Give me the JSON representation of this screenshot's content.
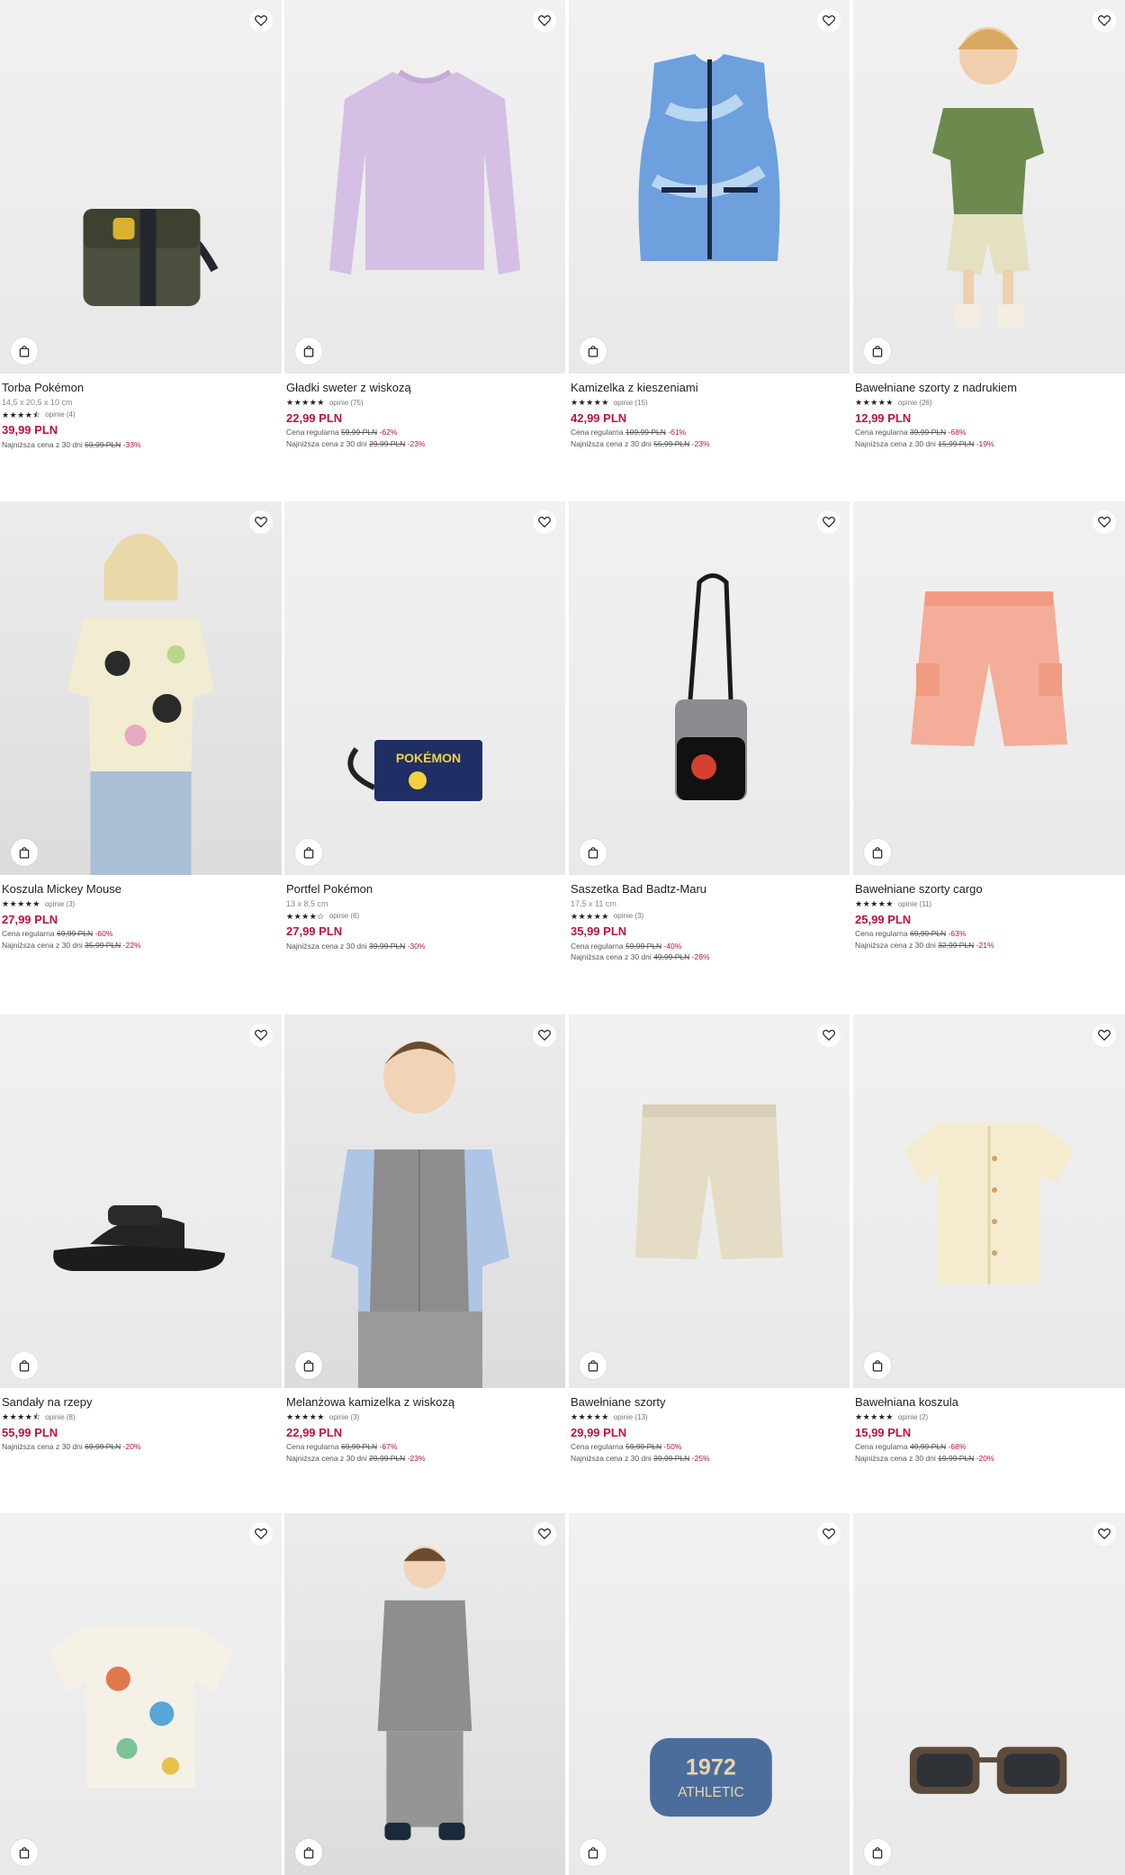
{
  "products": [
    {
      "name": "Torba Pokémon",
      "dims": "14,5 x 20,5 x 10 cm",
      "stars": "★★★★⯪",
      "reviews": "opinie (4)",
      "price": "39,99 PLN",
      "regular_label": "",
      "regular_old": "",
      "regular_disc": "",
      "lowest_label": "Najniższa cena z 30 dni",
      "lowest_old": "59,99 PLN",
      "lowest_disc": "-33%"
    },
    {
      "name": "Gładki sweter z wiskozą",
      "dims": "",
      "stars": "★★★★★",
      "reviews": "opinie (75)",
      "price": "22,99 PLN",
      "regular_label": "Cena regularna",
      "regular_old": "59,99 PLN",
      "regular_disc": "-62%",
      "lowest_label": "Najniższa cena z 30 dni",
      "lowest_old": "29,99 PLN",
      "lowest_disc": "-23%"
    },
    {
      "name": "Kamizelka z kieszeniami",
      "dims": "",
      "stars": "★★★★★",
      "reviews": "opinie (15)",
      "price": "42,99 PLN",
      "regular_label": "Cena regularna",
      "regular_old": "109,99 PLN",
      "regular_disc": "-61%",
      "lowest_label": "Najniższa cena z 30 dni",
      "lowest_old": "55,99 PLN",
      "lowest_disc": "-23%"
    },
    {
      "name": "Bawełniane szorty z nadrukiem",
      "dims": "",
      "stars": "★★★★★",
      "reviews": "opinie (26)",
      "price": "12,99 PLN",
      "regular_label": "Cena regularna",
      "regular_old": "39,99 PLN",
      "regular_disc": "-68%",
      "lowest_label": "Najniższa cena z 30 dni",
      "lowest_old": "15,99 PLN",
      "lowest_disc": "-19%"
    },
    {
      "name": "Koszula Mickey Mouse",
      "dims": "",
      "stars": "★★★★★",
      "reviews": "opinie (3)",
      "price": "27,99 PLN",
      "regular_label": "Cena regularna",
      "regular_old": "69,99 PLN",
      "regular_disc": "-60%",
      "lowest_label": "Najniższa cena z 30 dni",
      "lowest_old": "35,99 PLN",
      "lowest_disc": "-22%"
    },
    {
      "name": "Portfel Pokémon",
      "dims": "13 x 8,5 cm",
      "stars": "★★★★☆",
      "reviews": "opinie (6)",
      "price": "27,99 PLN",
      "regular_label": "",
      "regular_old": "",
      "regular_disc": "",
      "lowest_label": "Najniższa cena z 30 dni",
      "lowest_old": "39,99 PLN",
      "lowest_disc": "-30%"
    },
    {
      "name": "Saszetka Bad Badtz-Maru",
      "dims": "17,5 x 11 cm",
      "stars": "★★★★★",
      "reviews": "opinie (3)",
      "price": "35,99 PLN",
      "regular_label": "Cena regularna",
      "regular_old": "59,99 PLN",
      "regular_disc": "-40%",
      "lowest_label": "Najniższa cena z 30 dni",
      "lowest_old": "49,99 PLN",
      "lowest_disc": "-28%"
    },
    {
      "name": "Bawełniane szorty cargo",
      "dims": "",
      "stars": "★★★★★",
      "reviews": "opinie (11)",
      "price": "25,99 PLN",
      "regular_label": "Cena regularna",
      "regular_old": "69,99 PLN",
      "regular_disc": "-63%",
      "lowest_label": "Najniższa cena z 30 dni",
      "lowest_old": "32,99 PLN",
      "lowest_disc": "-21%"
    },
    {
      "name": "Sandały na rzepy",
      "dims": "",
      "stars": "★★★★⯪",
      "reviews": "opinie (8)",
      "price": "55,99 PLN",
      "regular_label": "",
      "regular_old": "",
      "regular_disc": "",
      "lowest_label": "Najniższa cena z 30 dni",
      "lowest_old": "69,99 PLN",
      "lowest_disc": "-20%"
    },
    {
      "name": "Melanżowa kamizelka z wiskozą",
      "dims": "",
      "stars": "★★★★★",
      "reviews": "opinie (3)",
      "price": "22,99 PLN",
      "regular_label": "Cena regularna",
      "regular_old": "69,99 PLN",
      "regular_disc": "-67%",
      "lowest_label": "Najniższa cena z 30 dni",
      "lowest_old": "29,99 PLN",
      "lowest_disc": "-23%"
    },
    {
      "name": "Bawełniane szorty",
      "dims": "",
      "stars": "★★★★★",
      "reviews": "opinie (13)",
      "price": "29,99 PLN",
      "regular_label": "Cena regularna",
      "regular_old": "59,99 PLN",
      "regular_disc": "-50%",
      "lowest_label": "Najniższa cena z 30 dni",
      "lowest_old": "39,99 PLN",
      "lowest_disc": "-25%"
    },
    {
      "name": "Bawełniana koszula",
      "dims": "",
      "stars": "★★★★★",
      "reviews": "opinie (2)",
      "price": "15,99 PLN",
      "regular_label": "Cena regularna",
      "regular_old": "49,99 PLN",
      "regular_disc": "-68%",
      "lowest_label": "Najniższa cena z 30 dni",
      "lowest_old": "19,99 PLN",
      "lowest_disc": "-20%"
    }
  ],
  "icons": {
    "favorite": "heart-icon",
    "add_to_cart": "shopping-bag-icon"
  },
  "colors": {
    "price": "#c3103c",
    "text": "#222222",
    "image_bg": "#ececec"
  }
}
